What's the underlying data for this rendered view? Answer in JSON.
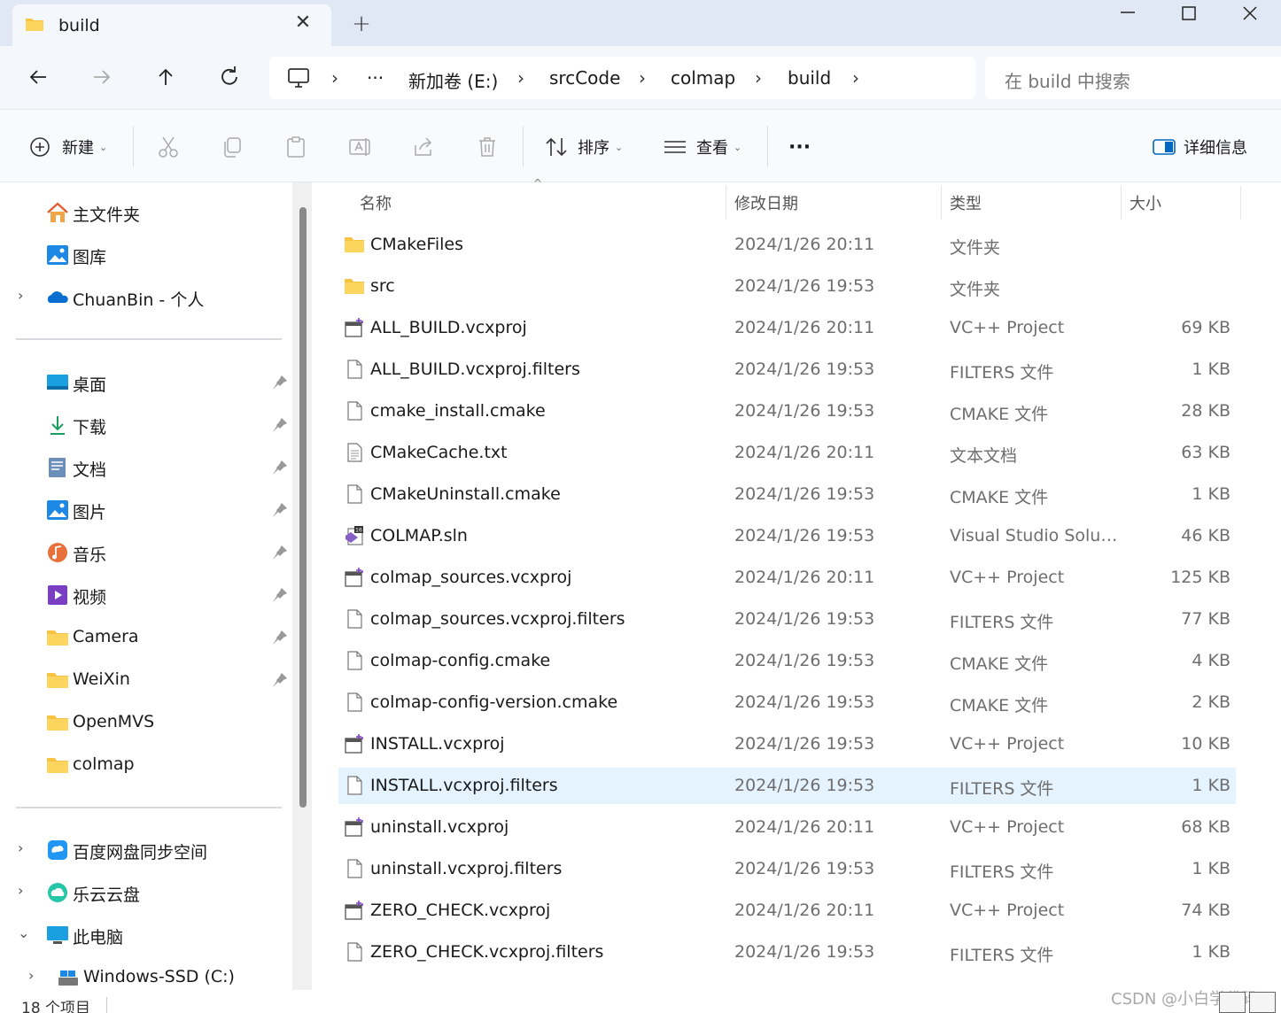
{
  "tab": {
    "title": "build"
  },
  "address": {
    "segments": [
      "新加卷 (E:)",
      "srcCode",
      "colmap",
      "build"
    ],
    "overflow": "···"
  },
  "search": {
    "placeholder": "在 build 中搜索"
  },
  "commands": {
    "new": "新建",
    "sort": "排序",
    "view": "查看",
    "more": "···",
    "details": "详细信息"
  },
  "sidebar": {
    "top": [
      {
        "label": "主文件夹",
        "icon": "home-icon"
      },
      {
        "label": "图库",
        "icon": "gallery-icon"
      },
      {
        "label": "ChuanBin - 个人",
        "icon": "onedrive-icon",
        "expandable": true
      }
    ],
    "pinned": [
      {
        "label": "桌面",
        "icon": "desktop-icon"
      },
      {
        "label": "下载",
        "icon": "download-icon"
      },
      {
        "label": "文档",
        "icon": "documents-icon"
      },
      {
        "label": "图片",
        "icon": "pictures-icon"
      },
      {
        "label": "音乐",
        "icon": "music-icon"
      },
      {
        "label": "视频",
        "icon": "videos-icon"
      },
      {
        "label": "Camera",
        "icon": "folder-icon"
      },
      {
        "label": "WeiXin",
        "icon": "folder-icon"
      },
      {
        "label": "OpenMVS",
        "icon": "folder-icon"
      },
      {
        "label": "colmap",
        "icon": "folder-icon"
      }
    ],
    "bottom": [
      {
        "label": "百度网盘同步空间",
        "icon": "baidu-netdisk-icon",
        "expander": "›"
      },
      {
        "label": "乐云云盘",
        "icon": "cloud-drive-icon",
        "expander": "›"
      },
      {
        "label": "此电脑",
        "icon": "this-pc-icon",
        "expander": "⌄"
      },
      {
        "label": "Windows-SSD (C:)",
        "icon": "drive-icon",
        "expander": "›"
      }
    ]
  },
  "columns": {
    "name": "名称",
    "date": "修改日期",
    "type": "类型",
    "size": "大小"
  },
  "files": [
    {
      "name": "CMakeFiles",
      "date": "2024/1/26 20:11",
      "type": "文件夹",
      "size": "",
      "icon": "folder"
    },
    {
      "name": "src",
      "date": "2024/1/26 19:53",
      "type": "文件夹",
      "size": "",
      "icon": "folder"
    },
    {
      "name": "ALL_BUILD.vcxproj",
      "date": "2024/1/26 20:11",
      "type": "VC++ Project",
      "size": "69 KB",
      "icon": "vcxproj"
    },
    {
      "name": "ALL_BUILD.vcxproj.filters",
      "date": "2024/1/26 19:53",
      "type": "FILTERS 文件",
      "size": "1 KB",
      "icon": "file"
    },
    {
      "name": "cmake_install.cmake",
      "date": "2024/1/26 19:53",
      "type": "CMAKE 文件",
      "size": "28 KB",
      "icon": "file"
    },
    {
      "name": "CMakeCache.txt",
      "date": "2024/1/26 20:11",
      "type": "文本文档",
      "size": "63 KB",
      "icon": "text"
    },
    {
      "name": "CMakeUninstall.cmake",
      "date": "2024/1/26 19:53",
      "type": "CMAKE 文件",
      "size": "1 KB",
      "icon": "file"
    },
    {
      "name": "COLMAP.sln",
      "date": "2024/1/26 19:53",
      "type": "Visual Studio Soluti...",
      "size": "46 KB",
      "icon": "sln"
    },
    {
      "name": "colmap_sources.vcxproj",
      "date": "2024/1/26 20:11",
      "type": "VC++ Project",
      "size": "125 KB",
      "icon": "vcxproj"
    },
    {
      "name": "colmap_sources.vcxproj.filters",
      "date": "2024/1/26 19:53",
      "type": "FILTERS 文件",
      "size": "77 KB",
      "icon": "file"
    },
    {
      "name": "colmap-config.cmake",
      "date": "2024/1/26 19:53",
      "type": "CMAKE 文件",
      "size": "4 KB",
      "icon": "file"
    },
    {
      "name": "colmap-config-version.cmake",
      "date": "2024/1/26 19:53",
      "type": "CMAKE 文件",
      "size": "2 KB",
      "icon": "file"
    },
    {
      "name": "INSTALL.vcxproj",
      "date": "2024/1/26 19:53",
      "type": "VC++ Project",
      "size": "10 KB",
      "icon": "vcxproj"
    },
    {
      "name": "INSTALL.vcxproj.filters",
      "date": "2024/1/26 19:53",
      "type": "FILTERS 文件",
      "size": "1 KB",
      "icon": "file",
      "selected": true
    },
    {
      "name": "uninstall.vcxproj",
      "date": "2024/1/26 20:11",
      "type": "VC++ Project",
      "size": "68 KB",
      "icon": "vcxproj"
    },
    {
      "name": "uninstall.vcxproj.filters",
      "date": "2024/1/26 19:53",
      "type": "FILTERS 文件",
      "size": "1 KB",
      "icon": "file"
    },
    {
      "name": "ZERO_CHECK.vcxproj",
      "date": "2024/1/26 20:11",
      "type": "VC++ Project",
      "size": "74 KB",
      "icon": "vcxproj"
    },
    {
      "name": "ZERO_CHECK.vcxproj.filters",
      "date": "2024/1/26 19:53",
      "type": "FILTERS 文件",
      "size": "1 KB",
      "icon": "file"
    }
  ],
  "status": {
    "count": "18 个项目"
  },
  "watermark": "CSDN @小白学代码i",
  "colors": {
    "accent": "#0067c0",
    "folder": "#f6c342",
    "selection": "#e5f3ff",
    "tabbar": "#dfe8f4"
  }
}
